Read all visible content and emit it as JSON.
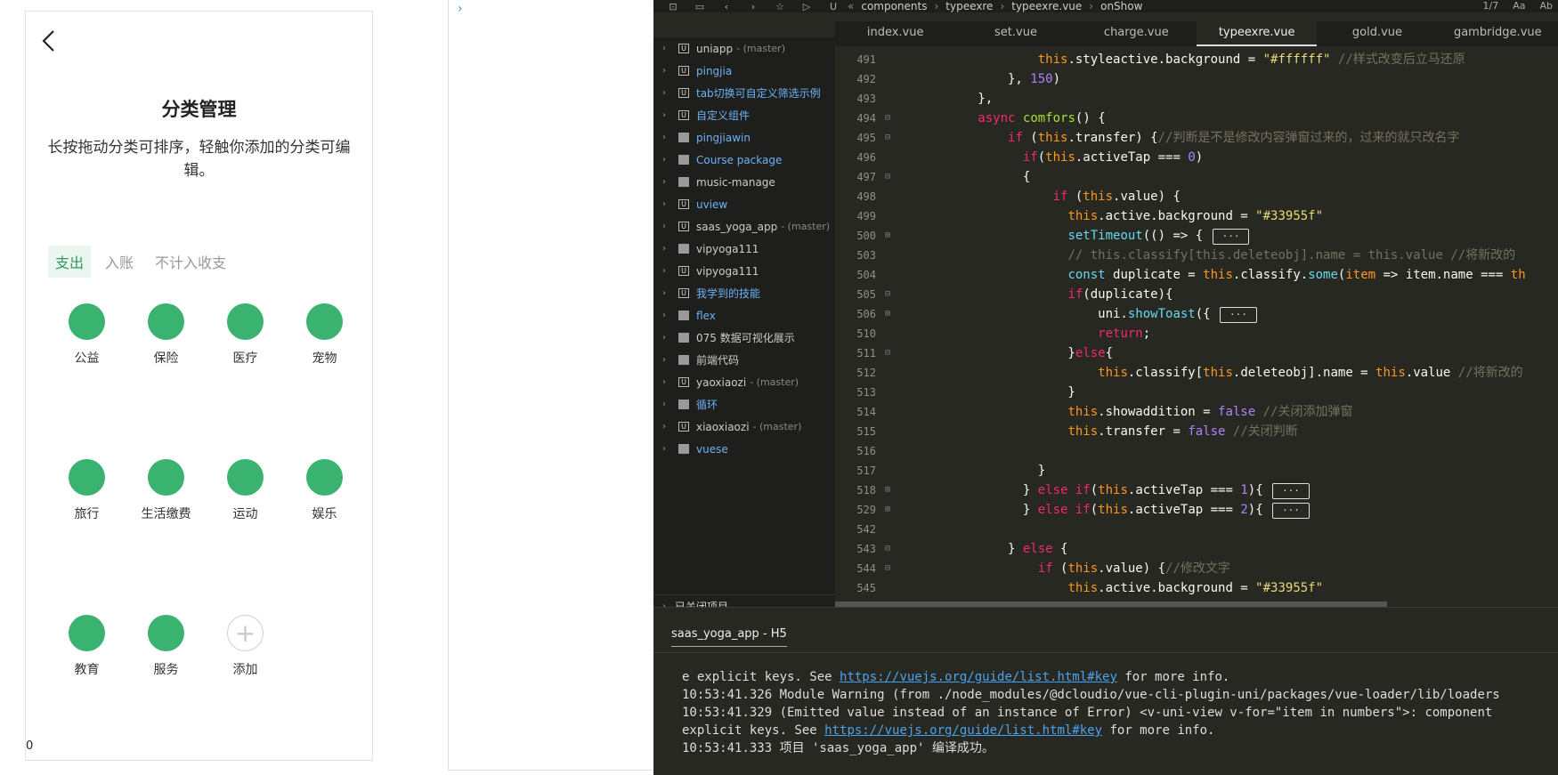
{
  "phone": {
    "title": "分类管理",
    "description": "长按拖动分类可排序，轻触你添加的分类可编辑。",
    "tabs": [
      "支出",
      "入账",
      "不计入收支"
    ],
    "categories": [
      "公益",
      "保险",
      "医疗",
      "宠物",
      "旅行",
      "生活缴费",
      "运动",
      "娱乐",
      "教育",
      "服务"
    ],
    "add_label": "添加",
    "bottom_text": "0",
    "accent": "#3ab370"
  },
  "ide": {
    "breadcrumbs": [
      "components",
      "typeexre",
      "typeexre.vue",
      "onShow"
    ],
    "toolbar_right": [
      "1/7",
      "Aa",
      "Ab"
    ],
    "file_tabs": [
      "index.vue",
      "set.vue",
      "charge.vue",
      "typeexre.vue",
      "gold.vue",
      "gambridge.vue"
    ],
    "active_tab": "typeexre.vue",
    "projects": [
      {
        "name": "uniapp",
        "branch": "- (master)",
        "icon": "uni-project-icon",
        "blue": false
      },
      {
        "name": "pingjia",
        "branch": "",
        "icon": "uni-project-icon",
        "blue": true
      },
      {
        "name": "tab切换可自定义筛选示例",
        "branch": "",
        "icon": "uni-project-icon",
        "blue": true
      },
      {
        "name": "自定义组件",
        "branch": "",
        "icon": "uni-project-icon",
        "blue": true
      },
      {
        "name": "pingjiawin",
        "branch": "",
        "icon": "folder-icon",
        "blue": true
      },
      {
        "name": "Course package",
        "branch": "",
        "icon": "folder-icon",
        "blue": true
      },
      {
        "name": "music-manage",
        "branch": "",
        "icon": "folder-icon",
        "blue": false
      },
      {
        "name": "uview",
        "branch": "",
        "icon": "uni-project-icon",
        "blue": true
      },
      {
        "name": "saas_yoga_app",
        "branch": "- (master)",
        "icon": "uni-project-icon",
        "blue": false
      },
      {
        "name": "vipyoga111",
        "branch": "",
        "icon": "folder-icon",
        "blue": false
      },
      {
        "name": "vipyoga111",
        "branch": "",
        "icon": "uni-project-icon",
        "blue": false
      },
      {
        "name": "我学到的技能",
        "branch": "",
        "icon": "uni-project-icon",
        "blue": true
      },
      {
        "name": "flex",
        "branch": "",
        "icon": "folder-icon",
        "blue": true
      },
      {
        "name": "075 数据可视化展示",
        "branch": "",
        "icon": "folder-icon",
        "blue": false
      },
      {
        "name": "前端代码",
        "branch": "",
        "icon": "folder-icon",
        "blue": false
      },
      {
        "name": "yaoxiaozi",
        "branch": "- (master)",
        "icon": "uni-project-icon",
        "blue": false
      },
      {
        "name": "循环",
        "branch": "",
        "icon": "folder-icon",
        "blue": true
      },
      {
        "name": "xiaoxiaozi",
        "branch": "- (master)",
        "icon": "uni-project-icon",
        "blue": false
      },
      {
        "name": "vuese",
        "branch": "",
        "icon": "folder-icon",
        "blue": true
      }
    ],
    "closed_projects_label": "已关闭项目",
    "code_lines": [
      {
        "n": "491",
        "fold": "",
        "html": "                  <span class='ths'>this</span>.styleactive.background = <span class='str'>\"#ffffff\"</span> <span class='cm'>//样式改变后立马还原</span>"
      },
      {
        "n": "492",
        "fold": "",
        "html": "              }, <span class='num'>150</span>)"
      },
      {
        "n": "493",
        "fold": "",
        "html": "          },"
      },
      {
        "n": "494",
        "fold": "⊟",
        "html": "          <span class='kw'>async</span> <span class='prop'>comfors</span>() {"
      },
      {
        "n": "495",
        "fold": "⊟",
        "html": "              <span class='kw'>if</span> (<span class='ths'>this</span>.transfer) {<span class='cm'>//判断是不是修改内容弹窗过来的，过来的就只改名字</span>"
      },
      {
        "n": "496",
        "fold": "",
        "html": "                <span class='kw'>if</span>(<span class='ths'>this</span>.activeTap === <span class='num'>0</span>)"
      },
      {
        "n": "497",
        "fold": "⊟",
        "html": "                {"
      },
      {
        "n": "498",
        "fold": "",
        "html": "                    <span class='kw'>if</span> (<span class='ths'>this</span>.value) {"
      },
      {
        "n": "499",
        "fold": "",
        "html": "                      <span class='ths'>this</span>.active.background = <span class='str'>\"#33955f\"</span>"
      },
      {
        "n": "500",
        "fold": "⊞",
        "html": "                      <span class='fn'>setTimeout</span>(() => { <span class='ellip'>···</span>"
      },
      {
        "n": "503",
        "fold": "",
        "html": "                      <span class='cm'>// this.classify[this.deleteobj].name = this.value //将新改的</span>"
      },
      {
        "n": "504",
        "fold": "",
        "html": "                      <span class='fn'>const</span> duplicate = <span class='ths'>this</span>.classify.<span class='fn'>some</span>(<span class='ths'>item</span> => item.name === <span class='ths'>th</span>"
      },
      {
        "n": "505",
        "fold": "⊟",
        "html": "                      <span class='kw'>if</span>(duplicate){"
      },
      {
        "n": "506",
        "fold": "⊞",
        "html": "                          uni.<span class='fn'>showToast</span>({ <span class='ellip'>···</span>"
      },
      {
        "n": "510",
        "fold": "",
        "html": "                          <span class='kw'>return</span>;"
      },
      {
        "n": "511",
        "fold": "⊟",
        "html": "                      }<span class='kw'>else</span>{"
      },
      {
        "n": "512",
        "fold": "",
        "html": "                          <span class='ths'>this</span>.classify[<span class='ths'>this</span>.deleteobj].name = <span class='ths'>this</span>.value <span class='cm'>//将新改的</span>"
      },
      {
        "n": "513",
        "fold": "",
        "html": "                      }"
      },
      {
        "n": "514",
        "fold": "",
        "html": "                      <span class='ths'>this</span>.showaddition = <span class='num'>false</span> <span class='cm'>//关闭添加弹窗</span>"
      },
      {
        "n": "515",
        "fold": "",
        "html": "                      <span class='ths'>this</span>.transfer = <span class='num'>false</span> <span class='cm'>//关闭判断</span>"
      },
      {
        "n": "516",
        "fold": "",
        "html": ""
      },
      {
        "n": "517",
        "fold": "",
        "html": "                  }"
      },
      {
        "n": "518",
        "fold": "⊞",
        "html": "                } <span class='kw'>else if</span>(<span class='ths'>this</span>.activeTap === <span class='num'>1</span>){ <span class='ellip'>···</span>"
      },
      {
        "n": "529",
        "fold": "⊞",
        "html": "                } <span class='kw'>else if</span>(<span class='ths'>this</span>.activeTap === <span class='num'>2</span>){ <span class='ellip'>···</span>"
      },
      {
        "n": "542",
        "fold": "",
        "html": ""
      },
      {
        "n": "543",
        "fold": "⊟",
        "html": "              } <span class='kw'>else</span> {"
      },
      {
        "n": "544",
        "fold": "⊟",
        "html": "                  <span class='kw'>if</span> (<span class='ths'>this</span>.value) {<span class='cm'>//修改文字</span>"
      },
      {
        "n": "545",
        "fold": "",
        "html": "                      <span class='ths'>this</span>.active.background = <span class='str'>\"#33955f\"</span>"
      }
    ],
    "console_tab": "saas_yoga_app - H5",
    "console_lines": [
      [
        {
          "t": "e explicit keys. See "
        },
        {
          "t": "https://vuejs.org/guide/list.html#key",
          "link": true
        },
        {
          "t": " for more info."
        }
      ],
      [
        {
          "t": "10:53:41.326 Module Warning (from ./node_modules/@dcloudio/vue-cli-plugin-uni/packages/vue-loader/lib/loaders"
        }
      ],
      [
        {
          "t": "10:53:41.329 (Emitted value instead of an instance of Error) <v-uni-view v-for=\"item in numbers\">: component"
        }
      ],
      [
        {
          "t": "explicit keys. See "
        },
        {
          "t": "https://vuejs.org/guide/list.html#key",
          "link": true
        },
        {
          "t": " for more info."
        }
      ],
      [
        {
          "t": "10:53:41.333 项目 'saas_yoga_app' 编译成功。"
        }
      ]
    ]
  }
}
